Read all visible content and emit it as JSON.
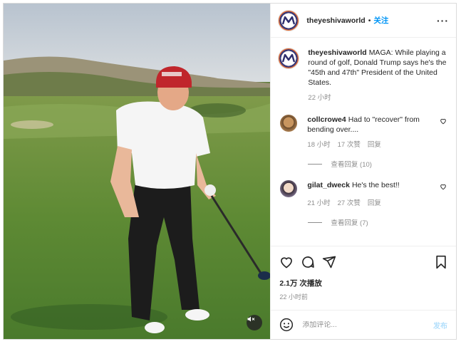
{
  "post": {
    "username": "theyeshivaworld",
    "follow_label": "关注",
    "more_icon": "more-horizontal-icon"
  },
  "caption": {
    "username": "theyeshivaworld",
    "text": "MAGA: While playing a round of golf, Donald Trump says he's the \"45th and 47th\" President of the United States.",
    "time": "22 小时"
  },
  "comments": [
    {
      "username": "collcrowe4",
      "text": "Had to \"recover\" from bending over....",
      "time": "18 小时",
      "likes": "17 次赞",
      "reply_label": "回复",
      "view_replies": "查看回复 (10)"
    },
    {
      "username": "gilat_dweck",
      "text": "He's the best!!",
      "time": "21 小时",
      "likes": "27 次赞",
      "reply_label": "回复",
      "view_replies": "查看回复 (7)"
    }
  ],
  "stats": {
    "views": "2.1万 次播放",
    "posted": "22 小时前"
  },
  "composer": {
    "placeholder": "添加评论...",
    "post_label": "发布"
  },
  "media": {
    "description_icons": [
      "volume-muted-icon"
    ]
  }
}
